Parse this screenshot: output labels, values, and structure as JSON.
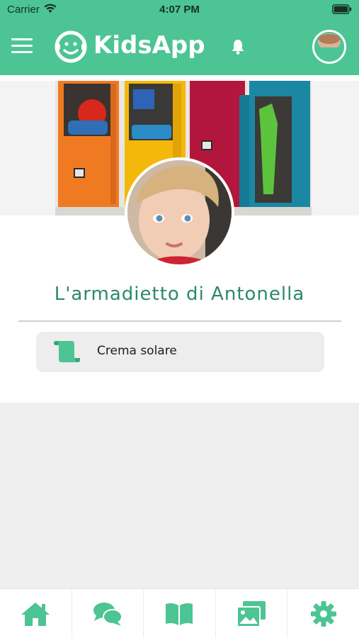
{
  "status_bar": {
    "carrier": "Carrier",
    "time": "4:07 PM"
  },
  "header": {
    "brand": "KidsApp",
    "icons": [
      "menu-icon",
      "kidsapp-logo",
      "bell-icon",
      "user-avatar"
    ]
  },
  "profile": {
    "title": "L'armadietto di Antonella",
    "cover_image": "colorful-school-lockers",
    "avatar_image": "toddler-portrait"
  },
  "items": [
    {
      "label": "Crema solare",
      "icon": "scroll-icon"
    }
  ],
  "tabs": [
    {
      "icon": "home-icon"
    },
    {
      "icon": "chat-icon"
    },
    {
      "icon": "book-icon"
    },
    {
      "icon": "gallery-icon"
    },
    {
      "icon": "settings-icon"
    }
  ],
  "colors": {
    "brand": "#4cc494",
    "title": "#2d8a66",
    "tab_icon": "#4cc494"
  }
}
